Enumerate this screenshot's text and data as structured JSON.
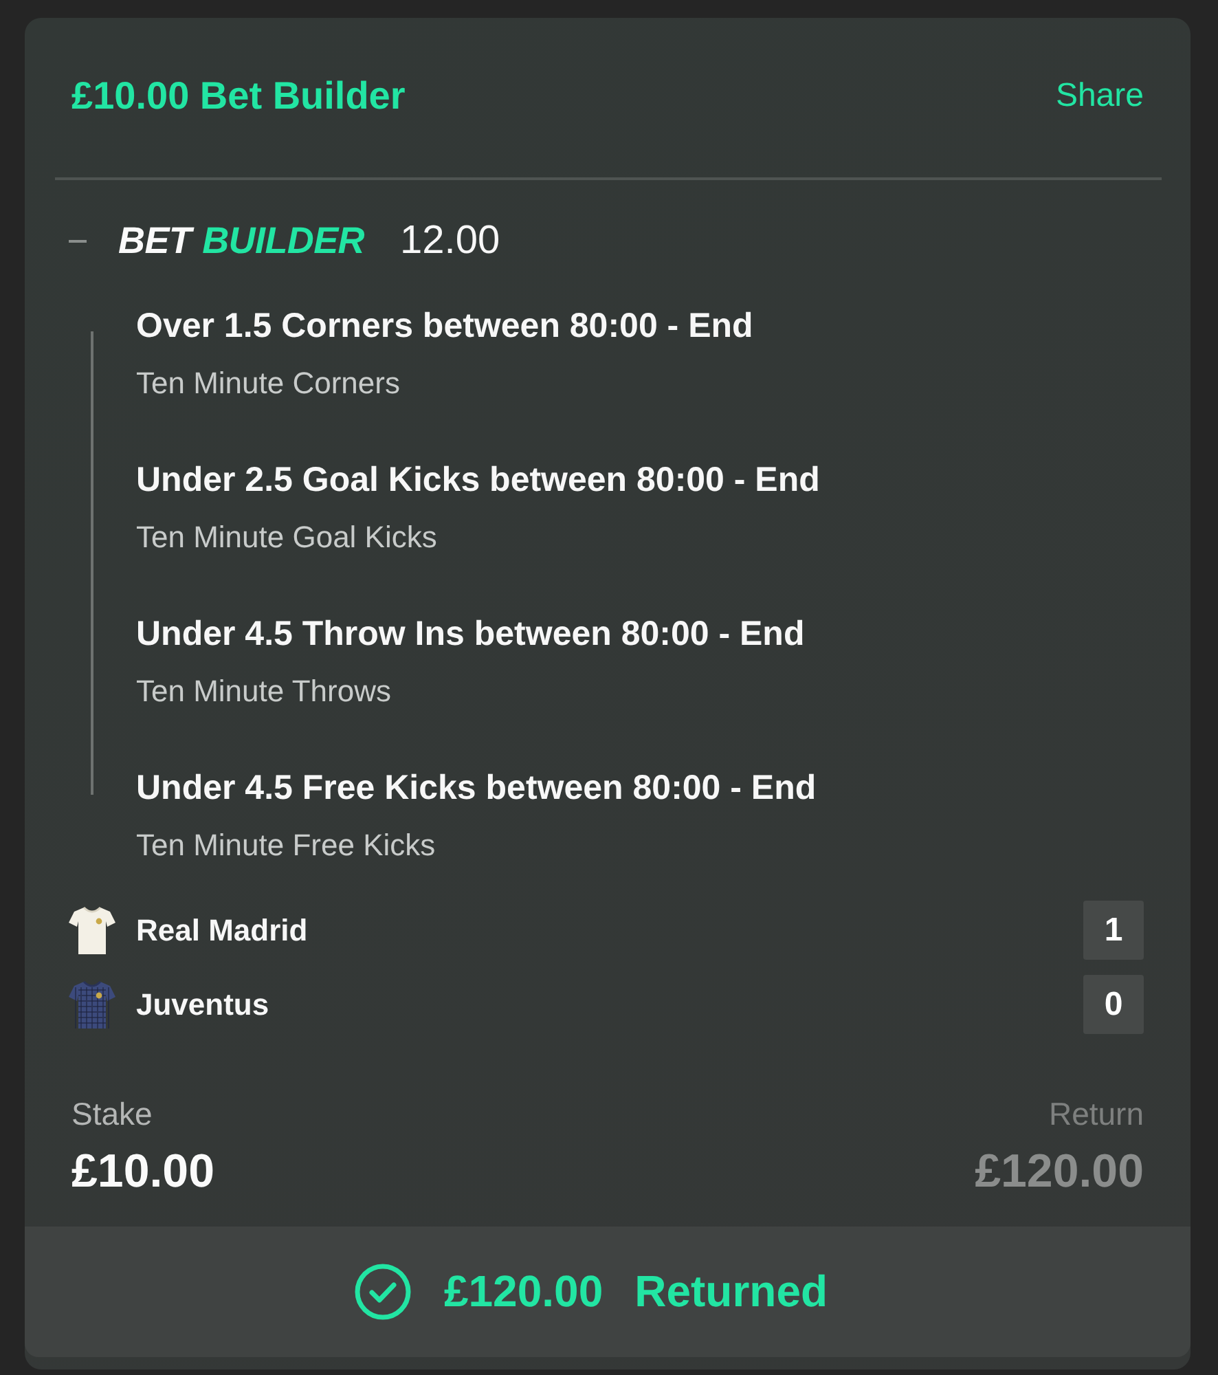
{
  "header": {
    "title": "£10.00 Bet Builder",
    "share": "Share"
  },
  "bet": {
    "expanded": true,
    "brand": [
      "BET",
      "BUILDER"
    ],
    "odds": "12.00",
    "legs": [
      {
        "title": "Over 1.5 Corners between 80:00 - End",
        "market": "Ten Minute Corners"
      },
      {
        "title": "Under 2.5 Goal Kicks between 80:00 - End",
        "market": "Ten Minute Goal Kicks"
      },
      {
        "title": "Under 4.5 Throw Ins between 80:00 - End",
        "market": "Ten Minute Throws"
      },
      {
        "title": "Under 4.5 Free Kicks between 80:00 - End",
        "market": "Ten Minute Free Kicks"
      }
    ]
  },
  "teams": [
    {
      "name": "Real Madrid",
      "score": "1",
      "kind": "plain",
      "color": "#f3f0e6"
    },
    {
      "name": "Juventus",
      "score": "0",
      "kind": "checked",
      "color": "#3c4a7c"
    }
  ],
  "stake": {
    "label": "Stake",
    "amount": "£10.00"
  },
  "return": {
    "label": "Return",
    "amount": "£120.00"
  },
  "status": {
    "amount": "£120.00",
    "text": "Returned"
  }
}
